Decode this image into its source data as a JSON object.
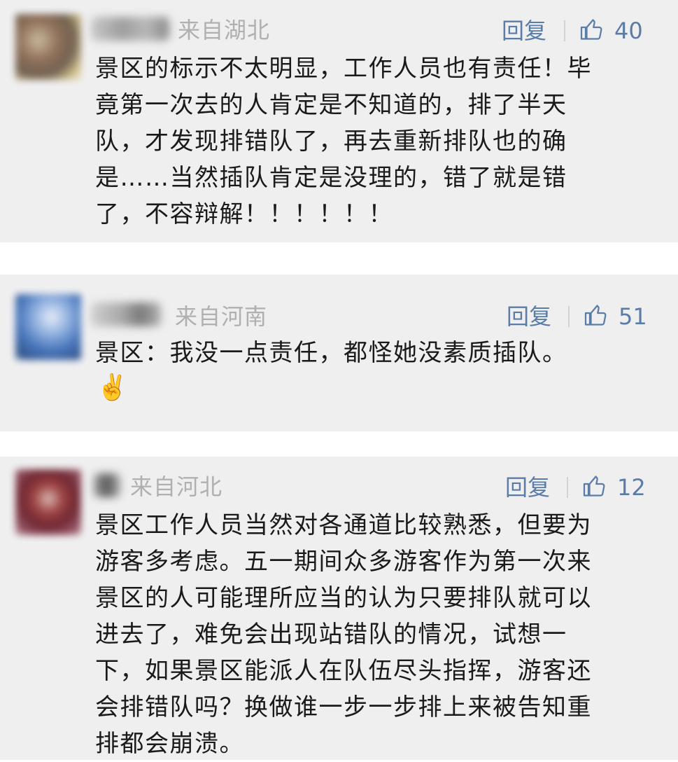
{
  "comments": [
    {
      "location": "来自湖北",
      "reply_label": "回复",
      "like_icon": "thumbs-up-icon",
      "likes": "40",
      "text": "景区的标示不太明显，工作人员也有责任！毕\n竟第一次去的人肯定是不知道的，排了半天\n队，才发现排错队了，再去重新排队也的确\n是……当然插队肯定是没理的，错了就是错\n了，不容辩解！！！！！！"
    },
    {
      "location": "来自河南",
      "reply_label": "回复",
      "like_icon": "thumbs-up-icon",
      "likes": "51",
      "text": "景区：我没一点责任，都怪她没素质插队。",
      "emoji": "✌️"
    },
    {
      "location": "来自河北",
      "reply_label": "回复",
      "like_icon": "thumbs-up-icon",
      "likes": "12",
      "text": "景区工作人员当然对各通道比较熟悉，但要为\n游客多考虑。五一期间众多游客作为第一次来\n景区的人可能理所应当的认为只要排队就可以\n进去了，难免会出现站错队的情况，试想一\n下，如果景区能派人在队伍尽头指挥，游客还\n会排错队吗？换做谁一步一步排上来被告知重\n排都会崩溃。"
    }
  ],
  "colors": {
    "card_bg": "#efeff0",
    "link_blue": "#5b7ca6",
    "location_gray": "#b0b0b0",
    "text": "#1a1a1a"
  }
}
